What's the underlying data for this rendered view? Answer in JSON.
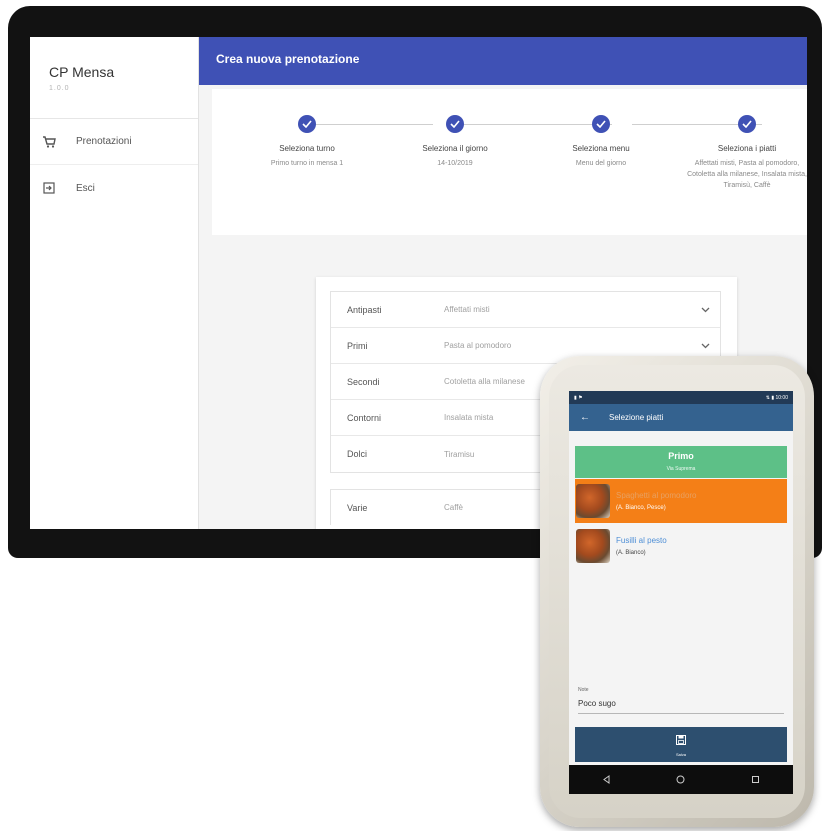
{
  "tablet": {
    "sidebar": {
      "title": "CP Mensa",
      "version": "1.0.0",
      "items": [
        {
          "label": "Prenotazioni",
          "icon": "cart-icon"
        },
        {
          "label": "Esci",
          "icon": "exit-icon"
        }
      ]
    },
    "appbar": {
      "title": "Crea nuova prenotazione"
    },
    "stepper": {
      "color": "#3f51b5",
      "steps": [
        {
          "label": "Seleziona turno",
          "value": "Primo turno in mensa 1"
        },
        {
          "label": "Seleziona il giorno",
          "value": "14-10/2019"
        },
        {
          "label": "Seleziona menu",
          "value": "Menu del giorno"
        },
        {
          "label": "Seleziona i piatti",
          "value": "Affettati misti, Pasta al pomodoro, Cotoletta alla milanese, Insalata mista, Tiramisù, Caffè"
        }
      ]
    },
    "menu": {
      "rows": [
        {
          "label": "Antipasti",
          "value": "Affettati misti"
        },
        {
          "label": "Primi",
          "value": "Pasta al pomodoro"
        },
        {
          "label": "Secondi",
          "value": "Cotoletta alla milanese"
        },
        {
          "label": "Contorni",
          "value": "Insalata mista"
        },
        {
          "label": "Dolci",
          "value": "Tiramisu"
        }
      ],
      "varie": {
        "label": "Varie",
        "value": "Caffè"
      }
    }
  },
  "phone": {
    "status": {
      "left": "▮ ⚑",
      "right": "⇅ ▮ 10:00"
    },
    "appbar": {
      "title": "Selezione piatti"
    },
    "category": {
      "name": "Primo",
      "sub": "Via Suprema",
      "color": "#5dc087"
    },
    "dishes": [
      {
        "name": "Spaghetti al pomodoro",
        "author": "(A. Bianco, Pesce)",
        "selected": true,
        "color": "#f47f17"
      },
      {
        "name": "Fusilli al pesto",
        "author": "(A. Bianco)",
        "selected": false
      }
    ],
    "note": {
      "label": "Note",
      "value": "Poco sugo"
    },
    "save": {
      "label": "Salva"
    }
  }
}
